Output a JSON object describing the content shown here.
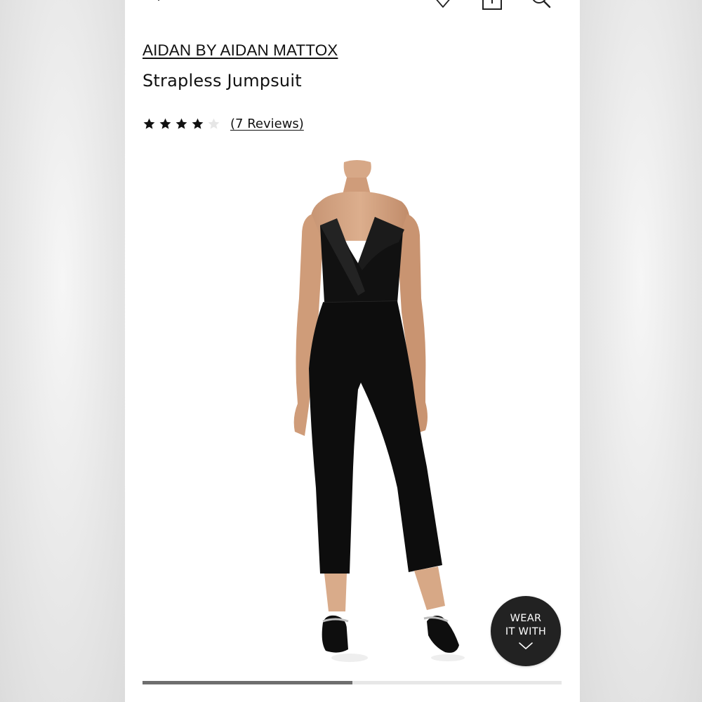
{
  "nav": {
    "back_icon": "chevron-left-icon",
    "wishlist_icon": "heart-icon",
    "bag_icon": "shopping-bag-icon",
    "search_icon": "search-icon"
  },
  "product": {
    "brand": "AIDAN BY AIDAN MATTOX",
    "name": "Strapless Jumpsuit",
    "rating": 4,
    "rating_max": 5,
    "reviews_label": "(7 Reviews)"
  },
  "image": {
    "subject": "model-wearing-black-strapless-jumpsuit"
  },
  "wear_it_with": {
    "line1": "WEAR",
    "line2": "IT WITH",
    "icon": "chevron-down-icon"
  },
  "carousel": {
    "progress": 0.5
  },
  "colors": {
    "text": "#111111",
    "button_bg": "#222222",
    "progress_fill": "#6e6e6e",
    "progress_track": "#e7e7e7"
  }
}
